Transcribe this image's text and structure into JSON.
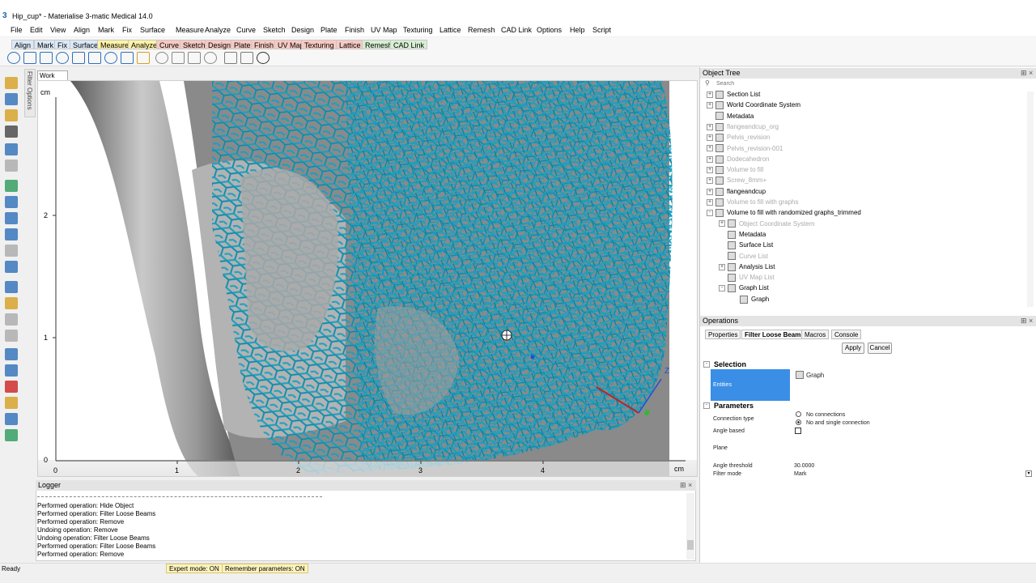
{
  "window": {
    "title": "Hip_cup* - Materialise 3-matic Medical 14.0",
    "logo_text": "3"
  },
  "menu": [
    "File",
    "Edit",
    "View",
    "Align",
    "Mark",
    "Fix",
    "Surface",
    "Measure",
    "Analyze",
    "Curve",
    "Sketch",
    "Design",
    "Plate",
    "Finish",
    "UV Map",
    "Texturing",
    "Lattice",
    "Remesh",
    "CAD Link",
    "Options",
    "Help",
    "Script"
  ],
  "ribbon_tabs": [
    {
      "label": "Align",
      "color": "#dbe8f7"
    },
    {
      "label": "Mark",
      "color": "#dbe8f7"
    },
    {
      "label": "Fix",
      "color": "#dbe8f7"
    },
    {
      "label": "Surface",
      "color": "#dbe8f7"
    },
    {
      "label": "Measure",
      "color": "#fff3a8"
    },
    {
      "label": "Analyze",
      "color": "#fff3a8"
    },
    {
      "label": "Curve",
      "color": "#f8c9c3"
    },
    {
      "label": "Sketch",
      "color": "#f8c9c3"
    },
    {
      "label": "Design",
      "color": "#f8c9c3"
    },
    {
      "label": "Plate",
      "color": "#f8c9c3"
    },
    {
      "label": "Finish",
      "color": "#f8c9c3"
    },
    {
      "label": "UV Map",
      "color": "#f8c9c3"
    },
    {
      "label": "Texturing",
      "color": "#f8c9c3"
    },
    {
      "label": "Lattice",
      "color": "#f8c9c3"
    },
    {
      "label": "Remesh",
      "color": "#d7efd2"
    },
    {
      "label": "CAD Link",
      "color": "#d7efd2"
    }
  ],
  "side_tab": "Filter Options",
  "work_area": {
    "tab": "Work Area",
    "unit": "cm",
    "y_ticks": [
      "2",
      "1",
      "0"
    ],
    "x_ticks": [
      "0",
      "1",
      "2",
      "3",
      "4"
    ],
    "x_unit": "cm",
    "axis_labels": {
      "z": "Z",
      "y": "Y"
    },
    "lattice_color": "#1a9fbf"
  },
  "object_tree": {
    "title": "Object Tree",
    "search_placeholder": "Search",
    "items": [
      {
        "label": "Section List",
        "depth": 0,
        "expand": "+",
        "dim": false
      },
      {
        "label": "World Coordinate System",
        "depth": 0,
        "expand": "+",
        "dim": false
      },
      {
        "label": "Metadata",
        "depth": 0,
        "expand": "",
        "dim": false
      },
      {
        "label": "flangeandcup_org",
        "depth": 0,
        "expand": "+",
        "dim": true
      },
      {
        "label": "Pelvis_revision",
        "depth": 0,
        "expand": "+",
        "dim": true
      },
      {
        "label": "Pelvis_revision-001",
        "depth": 0,
        "expand": "+",
        "dim": true
      },
      {
        "label": "Dodecahedron",
        "depth": 0,
        "expand": "+",
        "dim": true
      },
      {
        "label": "Volume to fill",
        "depth": 0,
        "expand": "+",
        "dim": true
      },
      {
        "label": "Screw_8mm+",
        "depth": 0,
        "expand": "+",
        "dim": true
      },
      {
        "label": "flangeandcup",
        "depth": 0,
        "expand": "+",
        "dim": false
      },
      {
        "label": "Volume to fill with graphs",
        "depth": 0,
        "expand": "+",
        "dim": true
      },
      {
        "label": "Volume to fill with randomized graphs_trimmed",
        "depth": 0,
        "expand": "-",
        "dim": false
      },
      {
        "label": "Object Coordinate System",
        "depth": 1,
        "expand": "+",
        "dim": true
      },
      {
        "label": "Metadata",
        "depth": 1,
        "expand": "",
        "dim": false
      },
      {
        "label": "Surface List",
        "depth": 1,
        "expand": "",
        "dim": false
      },
      {
        "label": "Curve List",
        "depth": 1,
        "expand": "",
        "dim": true
      },
      {
        "label": "Analysis List",
        "depth": 1,
        "expand": "+",
        "dim": false
      },
      {
        "label": "UV Map List",
        "depth": 1,
        "expand": "",
        "dim": true
      },
      {
        "label": "Graph List",
        "depth": 1,
        "expand": "-",
        "dim": false
      },
      {
        "label": "Graph",
        "depth": 2,
        "expand": "",
        "dim": false
      }
    ]
  },
  "operations": {
    "title": "Operations",
    "tabs": [
      "Properties",
      "Filter Loose Beams",
      "Macros",
      "Console"
    ],
    "active_tab": 1,
    "apply": "Apply",
    "cancel": "Cancel",
    "selection_header": "Selection",
    "entities_label": "Entities",
    "entities_value": "Graph",
    "parameters_header": "Parameters",
    "connection_type_label": "Connection type",
    "connection_options": [
      "No connections",
      "No and single connection"
    ],
    "connection_selected": 1,
    "angle_based_label": "Angle based",
    "angle_based_checked": false,
    "plane_label": "Plane",
    "angle_threshold_label": "Angle threshold",
    "angle_threshold_value": "30.0000",
    "filter_mode_label": "Filter mode",
    "filter_mode_value": "Mark"
  },
  "logger": {
    "title": "Logger",
    "lines": [
      "Performed operation: Hide Object",
      "Performed operation: Filter Loose Beams",
      "Performed operation: Remove",
      "Undoing operation: Remove",
      "Undoing operation: Filter Loose Beams",
      "Performed operation: Filter Loose Beams",
      "Performed operation: Remove"
    ]
  },
  "status": {
    "text": "Ready",
    "expert_mode": "Expert mode: ON",
    "remember_params": "Remember parameters: ON"
  }
}
